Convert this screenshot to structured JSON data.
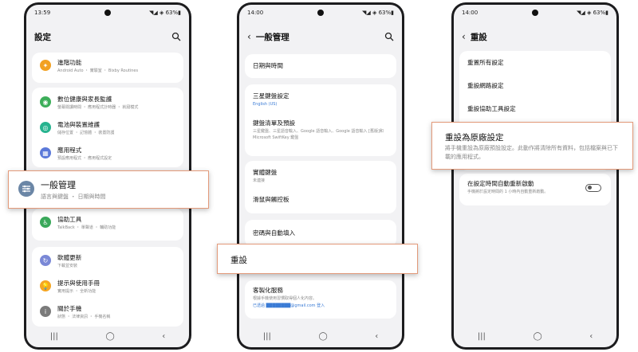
{
  "phone1": {
    "time": "13:59",
    "status_right": "◥◢ ◈ 63%▮",
    "title": "設定",
    "items": [
      {
        "title": "進階功能",
        "subtitle": "Android Auto ・ 實驗室 ・ Bixby Routines",
        "color": "#f2a122"
      },
      {
        "title": "數位健康與家長監護",
        "subtitle": "螢幕閱讀時間 ・ 應用程式計時器 ・ 就寢模式",
        "color": "#3dae5a"
      },
      {
        "title": "電池與裝置維護",
        "subtitle": "儲存位置 ・ 記憶體 ・ 裝置防護",
        "color": "#27b38f"
      },
      {
        "title": "應用程式",
        "subtitle": "預設應用程式 ・ 應用程式設定",
        "color": "#5b79d9"
      },
      {
        "title": "協助工具",
        "subtitle": "TalkBack ・ 單聲道 ・ 輔助功能",
        "color": "#3aa85a"
      },
      {
        "title": "軟體更新",
        "subtitle": "下載並安裝",
        "color": "#7a88d6"
      },
      {
        "title": "提示與使用手冊",
        "subtitle": "實用提示 ・ 全新功能",
        "color": "#f5a623"
      },
      {
        "title": "關於手機",
        "subtitle": "狀態 ・ 法律資訊 ・ 手機名稱",
        "color": "#7b7b7b"
      }
    ],
    "callout": {
      "title": "一般管理",
      "subtitle": "語言與鍵盤 ・ 日期與時間",
      "color": "#6b86a6"
    }
  },
  "phone2": {
    "time": "14:00",
    "status_right": "◥◢ ◈ 63%▮",
    "title": "一般管理",
    "items": [
      {
        "title": "日期與時間",
        "subtitle": ""
      },
      {
        "title": "三星鍵盤設定",
        "subtitle": "English (US)"
      },
      {
        "title": "鍵盤清單及預設",
        "subtitle": "三星鍵盤、三星語音輸入、Google 語音輸入、Google 語音輸入 [舊版]和Microsoft SwiftKey 鍵盤"
      },
      {
        "title": "實體鍵盤",
        "subtitle": "未連接"
      },
      {
        "title": "滑鼠與觸控板",
        "subtitle": ""
      },
      {
        "title": "密碼與自動填入",
        "subtitle": ""
      },
      {
        "title": "客製化服務",
        "subtitle": "根據手機使用習慣取得個人化內容。",
        "subtitle2": "已透過 ████████@gmail.com 登入"
      }
    ],
    "callout": {
      "title": "重設"
    }
  },
  "phone3": {
    "time": "14:00",
    "status_right": "◥◢ ◈ 63%▮",
    "title": "重設",
    "items": [
      {
        "title": "重置所有設定"
      },
      {
        "title": "重設網路設定"
      },
      {
        "title": "重設協助工具設定"
      }
    ],
    "callout": {
      "title": "重設為原廠設定",
      "subtitle": "將手機重設為原廠預設設定。此動作將清除所有資料，包括檔案與已下載的應用程式。"
    },
    "auto_restart": {
      "title": "在設定時間自動重新啟動",
      "subtitle": "手機將於設定時間的 1 小時內自動重新啟動。"
    }
  },
  "nav": {
    "recents": "|||",
    "home": "◯",
    "back": "‹"
  }
}
